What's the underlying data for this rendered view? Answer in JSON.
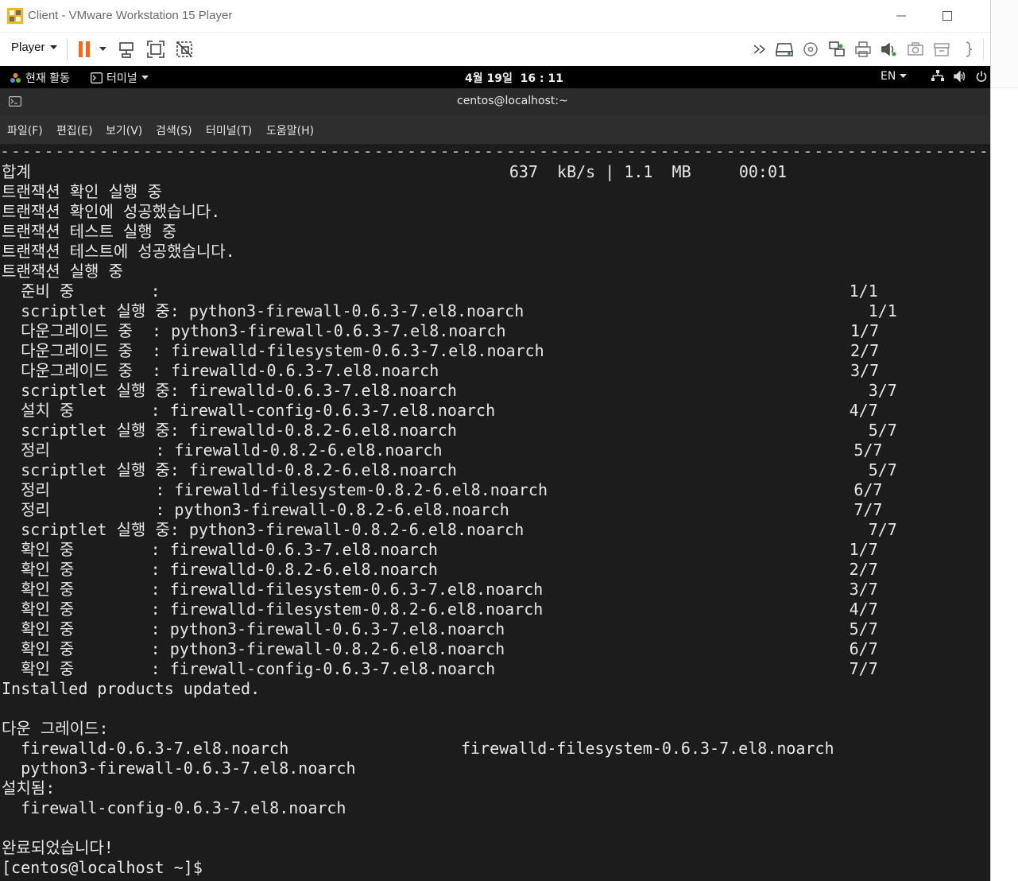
{
  "window": {
    "title": "Client - VMware Workstation 15 Player"
  },
  "toolbar": {
    "player_label": "Player"
  },
  "gnome": {
    "activities": "현재 활동",
    "terminal_app": "터미널",
    "clock": "4월 19일  16 : 11",
    "lang": "EN"
  },
  "terminal": {
    "title": "centos@localhost:~",
    "menu": [
      "파일(F)",
      "편집(E)",
      "보기(V)",
      "검색(S)",
      "터미널(T)",
      "도움말(H)"
    ],
    "lines": [
      "----------------------------------------------------------------------------------------------",
      "합계                                                  637  kB/s | 1.1  MB     00:01",
      "트랜잭션 확인 실행 중",
      "트랜잭션 확인에 성공했습니다.",
      "트랜잭션 테스트 실행 중",
      "트랜잭션 테스트에 성공했습니다.",
      "트랜잭션 실행 중",
      "  준비 중        :                                                                        1/1",
      "  scriptlet 실행 중: python3-firewall-0.6.3-7.el8.noarch                                    1/1",
      "  다운그레이드 중  : python3-firewall-0.6.3-7.el8.noarch                                    1/7",
      "  다운그레이드 중  : firewalld-filesystem-0.6.3-7.el8.noarch                                2/7",
      "  다운그레이드 중  : firewalld-0.6.3-7.el8.noarch                                           3/7",
      "  scriptlet 실행 중: firewalld-0.6.3-7.el8.noarch                                           3/7",
      "  설치 중        : firewall-config-0.6.3-7.el8.noarch                                     4/7",
      "  scriptlet 실행 중: firewalld-0.8.2-6.el8.noarch                                           5/7",
      "  정리           : firewalld-0.8.2-6.el8.noarch                                           5/7",
      "  scriptlet 실행 중: firewalld-0.8.2-6.el8.noarch                                           5/7",
      "  정리           : firewalld-filesystem-0.8.2-6.el8.noarch                                6/7",
      "  정리           : python3-firewall-0.8.2-6.el8.noarch                                    7/7",
      "  scriptlet 실행 중: python3-firewall-0.8.2-6.el8.noarch                                    7/7",
      "  확인 중        : firewalld-0.6.3-7.el8.noarch                                           1/7",
      "  확인 중        : firewalld-0.8.2-6.el8.noarch                                           2/7",
      "  확인 중        : firewalld-filesystem-0.6.3-7.el8.noarch                                3/7",
      "  확인 중        : firewalld-filesystem-0.8.2-6.el8.noarch                                4/7",
      "  확인 중        : python3-firewall-0.6.3-7.el8.noarch                                    5/7",
      "  확인 중        : python3-firewall-0.8.2-6.el8.noarch                                    6/7",
      "  확인 중        : firewall-config-0.6.3-7.el8.noarch                                     7/7",
      "Installed products updated.",
      "",
      "다운 그레이드:",
      "  firewalld-0.6.3-7.el8.noarch                  firewalld-filesystem-0.6.3-7.el8.noarch",
      "  python3-firewall-0.6.3-7.el8.noarch",
      "설치됨:",
      "  firewall-config-0.6.3-7.el8.noarch",
      "",
      "완료되었습니다!",
      "[centos@localhost ~]$ "
    ]
  },
  "colors": {
    "terminal_bg": "#1c1c1c",
    "terminal_fg": "#e6e6e6",
    "pause_orange": "#f26b1d"
  }
}
